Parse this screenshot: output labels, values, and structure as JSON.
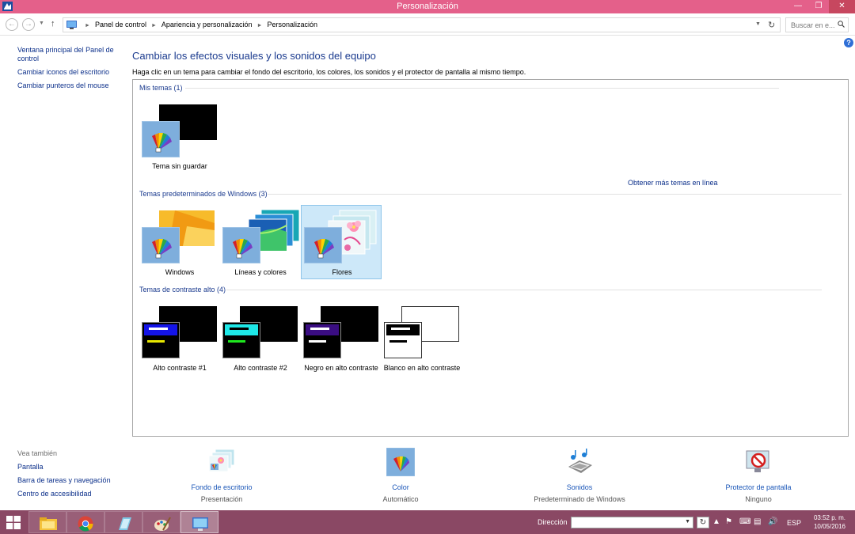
{
  "window": {
    "title": "Personalización"
  },
  "address": {
    "crumbs": [
      "Panel de control",
      "Apariencia y personalización",
      "Personalización"
    ],
    "search_placeholder": "Buscar en e..."
  },
  "leftnav": {
    "items": [
      "Ventana principal del Panel de control",
      "Cambiar iconos del escritorio",
      "Cambiar punteros del mouse"
    ],
    "see_also_header": "Vea también",
    "see_also": [
      "Pantalla",
      "Barra de tareas y navegación",
      "Centro de accesibilidad"
    ]
  },
  "main": {
    "heading": "Cambiar los efectos visuales y los sonidos del equipo",
    "subtext": "Haga clic en un tema para cambiar el fondo del escritorio, los colores, los sonidos y el protector de pantalla al mismo tiempo.",
    "more_themes_link": "Obtener más temas en línea",
    "sections": [
      {
        "title": "Mis temas (1)",
        "themes": [
          {
            "label": "Tema sin guardar"
          }
        ]
      },
      {
        "title": "Temas predeterminados de Windows (3)",
        "themes": [
          {
            "label": "Windows"
          },
          {
            "label": "Líneas y colores"
          },
          {
            "label": "Flores",
            "selected": true
          }
        ]
      },
      {
        "title": "Temas de contraste alto (4)",
        "themes": [
          {
            "label": "Alto contraste #1"
          },
          {
            "label": "Alto contraste #2"
          },
          {
            "label": "Negro en alto contraste"
          },
          {
            "label": "Blanco en alto contraste"
          }
        ]
      }
    ]
  },
  "bottom": [
    {
      "link": "Fondo de escritorio",
      "sub": "Presentación",
      "icon": "desktop-background-icon"
    },
    {
      "link": "Color",
      "sub": "Automático",
      "icon": "color-palette-icon"
    },
    {
      "link": "Sonidos",
      "sub": "Predeterminado de Windows",
      "icon": "sounds-icon"
    },
    {
      "link": "Protector de pantalla",
      "sub": "Ninguno",
      "icon": "screensaver-icon"
    }
  ],
  "taskbar": {
    "address_label": "Dirección",
    "lang": "ESP",
    "time": "03:52 p. m.",
    "date": "10/05/2016",
    "apps": [
      "file-explorer-icon",
      "chrome-icon",
      "app-icon",
      "paint-icon",
      "control-panel-icon"
    ]
  },
  "colors": {
    "title_bar": "#e4608a",
    "taskbar": "#8a4864",
    "link": "#1a3a8e",
    "selected": "#cde8f9"
  }
}
